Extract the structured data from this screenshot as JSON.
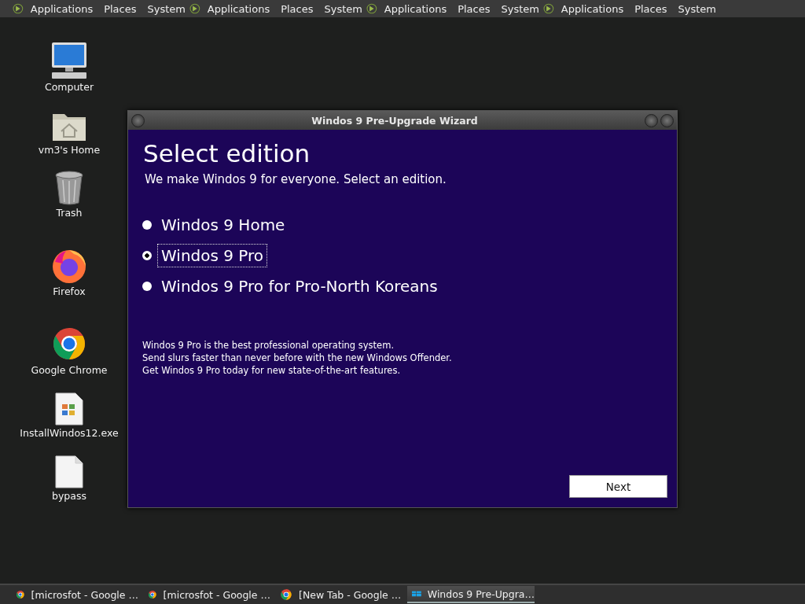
{
  "top_panels": [
    {
      "menus": [
        "Applications",
        "Places",
        "System"
      ]
    },
    {
      "menus": [
        "Applications",
        "Places",
        "System"
      ]
    },
    {
      "menus": [
        "Applications",
        "Places",
        "System"
      ]
    },
    {
      "menus": [
        "Applications",
        "Places",
        "System"
      ]
    }
  ],
  "desktop_icons": [
    {
      "kind": "computer",
      "label": "Computer"
    },
    {
      "kind": "home",
      "label": "vm3's Home"
    },
    {
      "kind": "trash",
      "label": "Trash"
    },
    {
      "kind": "firefox",
      "label": "Firefox"
    },
    {
      "kind": "chrome",
      "label": "Google Chrome"
    },
    {
      "kind": "installer",
      "label": "InstallWindos12.exe"
    },
    {
      "kind": "file",
      "label": "bypass"
    }
  ],
  "window": {
    "title": "Windos 9 Pre-Upgrade Wizard",
    "heading": "Select edition",
    "subtitle": "We make Windos 9 for everyone. Select an edition.",
    "options": [
      {
        "label": "Windos 9 Home",
        "selected": false
      },
      {
        "label": "Windos 9 Pro",
        "selected": true
      },
      {
        "label": "Windos 9 Pro for Pro-North Koreans",
        "selected": false
      }
    ],
    "description": [
      "Windos 9 Pro is the best professional operating system.",
      "Send slurs faster than never before with the new Windows Offender.",
      "Get Windos 9 Pro today for new state-of-the-art features."
    ],
    "next_button": "Next"
  },
  "taskbar": [
    {
      "kind": "chrome",
      "label": "[microsfot - Google …",
      "selected": false
    },
    {
      "kind": "chrome",
      "label": "[microsfot - Google …",
      "selected": false
    },
    {
      "kind": "chrome",
      "label": "[New Tab - Google …",
      "selected": false
    },
    {
      "kind": "wizard",
      "label": "Windos 9 Pre-Upgra…",
      "selected": true
    }
  ]
}
